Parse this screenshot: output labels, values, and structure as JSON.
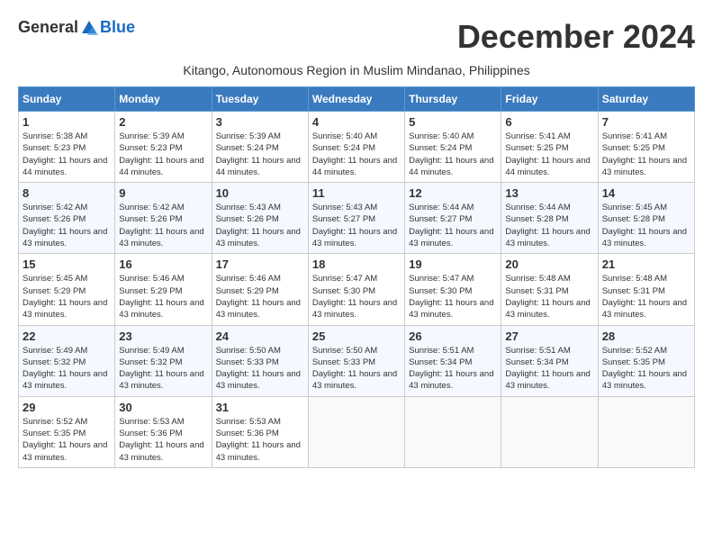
{
  "header": {
    "logo_general": "General",
    "logo_blue": "Blue",
    "month_title": "December 2024",
    "location": "Kitango, Autonomous Region in Muslim Mindanao, Philippines"
  },
  "days_of_week": [
    "Sunday",
    "Monday",
    "Tuesday",
    "Wednesday",
    "Thursday",
    "Friday",
    "Saturday"
  ],
  "weeks": [
    [
      {
        "day": "1",
        "sunrise": "5:38 AM",
        "sunset": "5:23 PM",
        "daylight": "11 hours and 44 minutes."
      },
      {
        "day": "2",
        "sunrise": "5:39 AM",
        "sunset": "5:23 PM",
        "daylight": "11 hours and 44 minutes."
      },
      {
        "day": "3",
        "sunrise": "5:39 AM",
        "sunset": "5:24 PM",
        "daylight": "11 hours and 44 minutes."
      },
      {
        "day": "4",
        "sunrise": "5:40 AM",
        "sunset": "5:24 PM",
        "daylight": "11 hours and 44 minutes."
      },
      {
        "day": "5",
        "sunrise": "5:40 AM",
        "sunset": "5:24 PM",
        "daylight": "11 hours and 44 minutes."
      },
      {
        "day": "6",
        "sunrise": "5:41 AM",
        "sunset": "5:25 PM",
        "daylight": "11 hours and 44 minutes."
      },
      {
        "day": "7",
        "sunrise": "5:41 AM",
        "sunset": "5:25 PM",
        "daylight": "11 hours and 43 minutes."
      }
    ],
    [
      {
        "day": "8",
        "sunrise": "5:42 AM",
        "sunset": "5:26 PM",
        "daylight": "11 hours and 43 minutes."
      },
      {
        "day": "9",
        "sunrise": "5:42 AM",
        "sunset": "5:26 PM",
        "daylight": "11 hours and 43 minutes."
      },
      {
        "day": "10",
        "sunrise": "5:43 AM",
        "sunset": "5:26 PM",
        "daylight": "11 hours and 43 minutes."
      },
      {
        "day": "11",
        "sunrise": "5:43 AM",
        "sunset": "5:27 PM",
        "daylight": "11 hours and 43 minutes."
      },
      {
        "day": "12",
        "sunrise": "5:44 AM",
        "sunset": "5:27 PM",
        "daylight": "11 hours and 43 minutes."
      },
      {
        "day": "13",
        "sunrise": "5:44 AM",
        "sunset": "5:28 PM",
        "daylight": "11 hours and 43 minutes."
      },
      {
        "day": "14",
        "sunrise": "5:45 AM",
        "sunset": "5:28 PM",
        "daylight": "11 hours and 43 minutes."
      }
    ],
    [
      {
        "day": "15",
        "sunrise": "5:45 AM",
        "sunset": "5:29 PM",
        "daylight": "11 hours and 43 minutes."
      },
      {
        "day": "16",
        "sunrise": "5:46 AM",
        "sunset": "5:29 PM",
        "daylight": "11 hours and 43 minutes."
      },
      {
        "day": "17",
        "sunrise": "5:46 AM",
        "sunset": "5:29 PM",
        "daylight": "11 hours and 43 minutes."
      },
      {
        "day": "18",
        "sunrise": "5:47 AM",
        "sunset": "5:30 PM",
        "daylight": "11 hours and 43 minutes."
      },
      {
        "day": "19",
        "sunrise": "5:47 AM",
        "sunset": "5:30 PM",
        "daylight": "11 hours and 43 minutes."
      },
      {
        "day": "20",
        "sunrise": "5:48 AM",
        "sunset": "5:31 PM",
        "daylight": "11 hours and 43 minutes."
      },
      {
        "day": "21",
        "sunrise": "5:48 AM",
        "sunset": "5:31 PM",
        "daylight": "11 hours and 43 minutes."
      }
    ],
    [
      {
        "day": "22",
        "sunrise": "5:49 AM",
        "sunset": "5:32 PM",
        "daylight": "11 hours and 43 minutes."
      },
      {
        "day": "23",
        "sunrise": "5:49 AM",
        "sunset": "5:32 PM",
        "daylight": "11 hours and 43 minutes."
      },
      {
        "day": "24",
        "sunrise": "5:50 AM",
        "sunset": "5:33 PM",
        "daylight": "11 hours and 43 minutes."
      },
      {
        "day": "25",
        "sunrise": "5:50 AM",
        "sunset": "5:33 PM",
        "daylight": "11 hours and 43 minutes."
      },
      {
        "day": "26",
        "sunrise": "5:51 AM",
        "sunset": "5:34 PM",
        "daylight": "11 hours and 43 minutes."
      },
      {
        "day": "27",
        "sunrise": "5:51 AM",
        "sunset": "5:34 PM",
        "daylight": "11 hours and 43 minutes."
      },
      {
        "day": "28",
        "sunrise": "5:52 AM",
        "sunset": "5:35 PM",
        "daylight": "11 hours and 43 minutes."
      }
    ],
    [
      {
        "day": "29",
        "sunrise": "5:52 AM",
        "sunset": "5:35 PM",
        "daylight": "11 hours and 43 minutes."
      },
      {
        "day": "30",
        "sunrise": "5:53 AM",
        "sunset": "5:36 PM",
        "daylight": "11 hours and 43 minutes."
      },
      {
        "day": "31",
        "sunrise": "5:53 AM",
        "sunset": "5:36 PM",
        "daylight": "11 hours and 43 minutes."
      },
      null,
      null,
      null,
      null
    ]
  ],
  "labels": {
    "sunrise": "Sunrise:",
    "sunset": "Sunset:",
    "daylight": "Daylight hours"
  }
}
